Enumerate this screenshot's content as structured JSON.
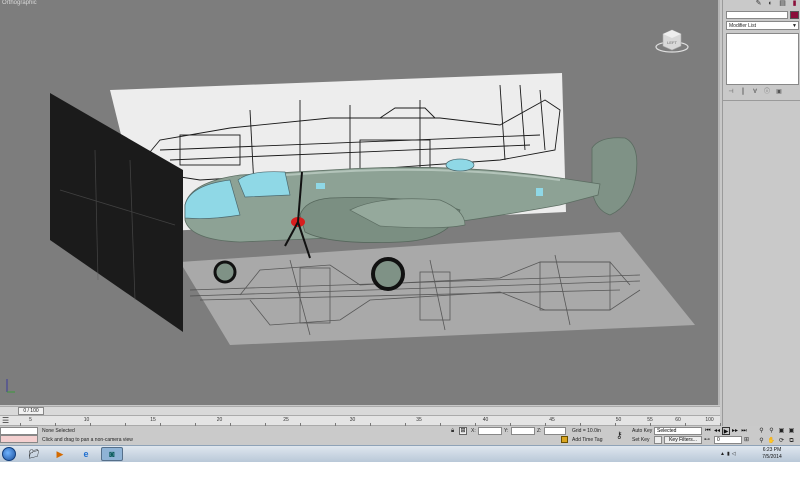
{
  "viewport": {
    "label": "Orthographic",
    "viewcube_face": "LEFT"
  },
  "command_panel": {
    "tabs": [
      "create-icon",
      "modify-icon",
      "hierarchy-icon",
      "motion-icon",
      "display-icon",
      "utilities-icon"
    ],
    "object_name": "",
    "object_color": "#8a0e3a",
    "modifier_list": "Modifier List"
  },
  "timeline": {
    "frame_display": "0 / 100",
    "ticks": [
      0,
      5,
      10,
      15,
      20,
      25,
      30,
      35,
      40,
      45,
      50,
      55,
      60,
      65,
      70,
      75,
      80,
      85,
      90,
      95,
      100
    ],
    "labels": [
      "10",
      "15",
      "20",
      "25",
      "30",
      "35",
      "40",
      "45",
      "50",
      "55",
      "60",
      "65",
      "70",
      "75",
      "80",
      "85",
      "90",
      "95",
      "100"
    ],
    "label_5": "5"
  },
  "status": {
    "selection": "None Selected",
    "prompt": "Click and drag to pan a non-camera view",
    "x_label": "X:",
    "y_label": "Y:",
    "z_label": "Z:",
    "grid": "Grid = 10.0in",
    "add_time_tag": "Add Time Tag"
  },
  "animation": {
    "auto_key": "Auto Key",
    "selection_mode": "Selected",
    "set_key": "Set Key",
    "key_filters": "Key Filters...",
    "current_frame": "0"
  },
  "taskbar": {
    "time": "6:23 PM",
    "date": "7/5/2014"
  }
}
